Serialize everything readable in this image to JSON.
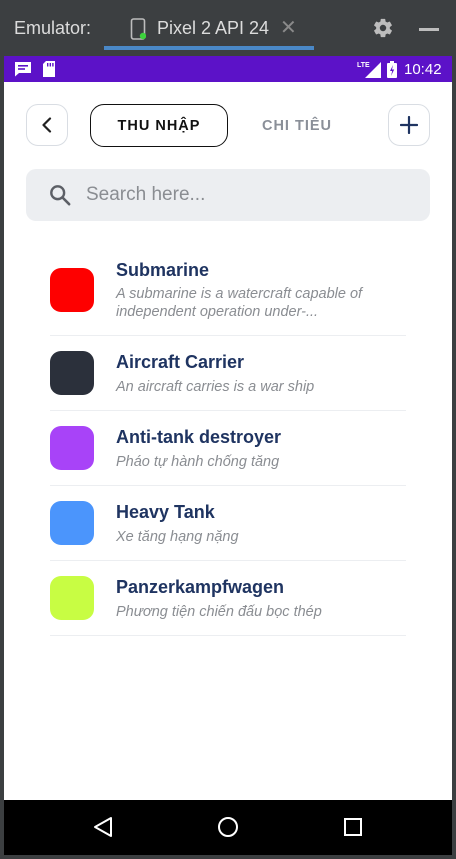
{
  "emulator": {
    "label": "Emulator:",
    "device_tab": "Pixel 2 API 24",
    "close_glyph": "✕",
    "icons": [
      "device-phone-icon",
      "close-icon",
      "gear-icon",
      "minimize-icon"
    ]
  },
  "status_bar": {
    "time": "10:42",
    "network": "LTE",
    "icons": [
      "message-icon",
      "sd-card-icon",
      "lte-signal-icon",
      "battery-icon"
    ]
  },
  "header": {
    "tabs": [
      {
        "label": "THU NHẬP",
        "active": true
      },
      {
        "label": "CHI TIÊU",
        "active": false
      }
    ],
    "icons": [
      "chevron-left-icon",
      "plus-icon"
    ]
  },
  "search": {
    "placeholder": "Search here...",
    "value": ""
  },
  "items": [
    {
      "title": "Submarine",
      "description": "A submarine is a watercraft capable of independent operation under-...",
      "color": "#fe0000"
    },
    {
      "title": "Aircraft Carrier",
      "description": "An aircraft carries is a war ship",
      "color": "#2b303b"
    },
    {
      "title": "Anti-tank destroyer",
      "description": "Pháo tự hành chống tăng",
      "color": "#a843f8"
    },
    {
      "title": "Heavy Tank",
      "description": "Xe tăng hạng nặng",
      "color": "#4b95fc"
    },
    {
      "title": "Panzerkampfwagen",
      "description": "Phương tiện chiến đấu bọc thép",
      "color": "#c8fd43"
    }
  ],
  "nav_bar": {
    "icons": [
      "nav-back-icon",
      "nav-home-icon",
      "nav-recents-icon"
    ]
  },
  "colors": {
    "status_bar": "#5c12c8",
    "title_text": "#1f3461",
    "accent_tab_underline": "#4a88c7"
  }
}
